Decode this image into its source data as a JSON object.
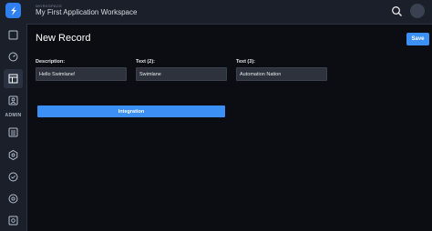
{
  "header": {
    "workspace_eyebrow": "WORKSPACE",
    "workspace_title": "My First Application Workspace"
  },
  "sidebar": {
    "section_label": "ADMIN",
    "items": [
      {
        "icon": "square-icon"
      },
      {
        "icon": "dashboard-icon"
      },
      {
        "icon": "record-grid-icon",
        "active": true
      },
      {
        "icon": "user-card-icon"
      },
      {
        "icon": "list-icon"
      },
      {
        "icon": "integration-hex-icon"
      },
      {
        "icon": "workflow-icon"
      },
      {
        "icon": "report-icon"
      },
      {
        "icon": "settings-icon"
      }
    ]
  },
  "page": {
    "title": "New Record",
    "save_label": "Save"
  },
  "form": {
    "fields": [
      {
        "label": "Description:",
        "value": "Hello Swimlane!"
      },
      {
        "label": "Text (2):",
        "value": "Swimlane"
      },
      {
        "label": "Text (3):",
        "value": "Automation Nation"
      }
    ],
    "integration_label": "Integration"
  },
  "colors": {
    "accent": "#3b8ff5",
    "background": "#0b0d12",
    "sidebar": "#1a1f29",
    "input": "#2d323c"
  }
}
